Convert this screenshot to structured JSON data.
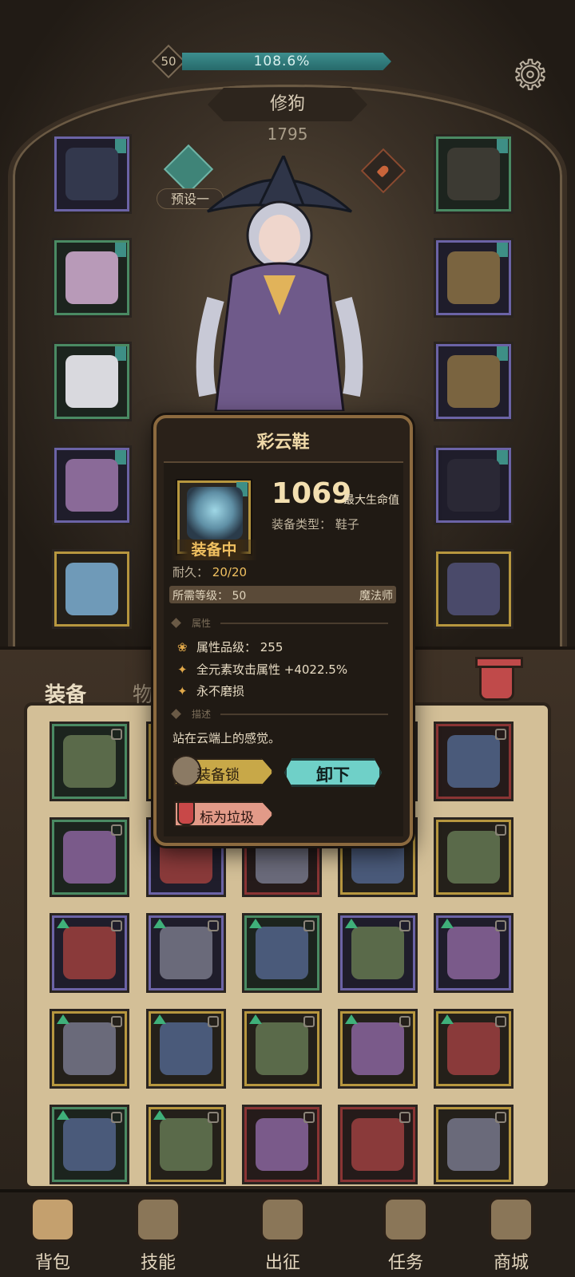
{
  "hud": {
    "level": "50",
    "exp_percent": "108.6%",
    "exp_fill": 1.0
  },
  "character": {
    "name": "修狗",
    "power": "1795",
    "preset_label": "预设一"
  },
  "icons": {
    "settings": "gear-icon",
    "preset": "preset-emblem-icon",
    "pin": "pin-icon",
    "trash": "trash-can-icon"
  },
  "left_slots": [
    {
      "item": "witch-hat-icon",
      "frame": "purple"
    },
    {
      "item": "witch-dress-icon",
      "frame": "green"
    },
    {
      "item": "glove-icon",
      "frame": "green"
    },
    {
      "item": "skirt-icon",
      "frame": "purple"
    },
    {
      "item": "shoes-icon",
      "frame": "gold"
    }
  ],
  "right_slots": [
    {
      "item": "amulet-icon",
      "frame": "green"
    },
    {
      "item": "ring-icon",
      "frame": "purple"
    },
    {
      "item": "ring-icon",
      "frame": "purple"
    },
    {
      "item": "wand-icon",
      "frame": "purple"
    },
    {
      "item": "bracer-icon",
      "frame": "gold"
    }
  ],
  "inventory": {
    "tab_equip": "装备",
    "tab_items": "物品",
    "grid": [
      [
        "green",
        "gold",
        "gray",
        "gray",
        "red"
      ],
      [
        "green",
        "purple",
        "red",
        "gold",
        "gold"
      ],
      [
        "purple",
        "purple",
        "green",
        "purple",
        "purple"
      ],
      [
        "gold",
        "gold",
        "gold",
        "gold",
        "gold"
      ],
      [
        "green",
        "gold",
        "red",
        "red",
        "gold"
      ]
    ]
  },
  "popup": {
    "title": "彩云鞋",
    "equipped_tag": "装备中",
    "stat_value": "1069",
    "stat_name": "最大生命值",
    "type_label": "装备类型：  鞋子",
    "durability_label": "耐久：",
    "durability_value": "20/20",
    "req_level": "所需等级：  50",
    "req_class": "魔法师",
    "section_attr": "属性",
    "attr_quality": "属性品级：  255",
    "attr_bonus": "全元素攻击属性 +4022.5%",
    "attr_unbreakable": "永不磨损",
    "section_desc": "描述",
    "description": "站在云端上的感觉。",
    "btn_lock": "装备锁",
    "btn_unequip": "卸下",
    "btn_trash": "标为垃圾"
  },
  "nav": [
    {
      "label": "背包",
      "icon": "backpack-icon"
    },
    {
      "label": "技能",
      "icon": "skill-book-icon"
    },
    {
      "label": "出征",
      "icon": "battle-map-icon"
    },
    {
      "label": "任务",
      "icon": "quest-scroll-icon"
    },
    {
      "label": "商城",
      "icon": "shop-crown-icon"
    }
  ],
  "colors": {
    "purple": "#6b63a6",
    "green": "#4a8a63",
    "gold": "#b7973f",
    "red": "#8a3434",
    "gray": "#4a4541",
    "accent_teal": "#3e8f86",
    "unequip_button": "#6fd0c8",
    "lock_button": "#c8a848",
    "trash_button": "#e29a88"
  }
}
